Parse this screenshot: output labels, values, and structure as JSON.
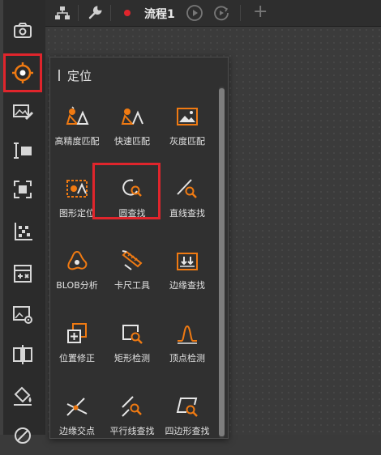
{
  "colors": {
    "accent": "#f07a12",
    "icon_gray": "#d7d7d7",
    "highlight_red": "#e0252c",
    "panel_bg": "#303030"
  },
  "left_toolbar": {
    "items": [
      {
        "name": "camera-icon"
      },
      {
        "name": "locate-target-icon",
        "active": true
      },
      {
        "name": "image-edit-icon"
      },
      {
        "name": "measure-icon"
      },
      {
        "name": "focus-frame-icon"
      },
      {
        "name": "grid-scatter-icon"
      },
      {
        "name": "calculator-icon"
      },
      {
        "name": "image-settings-icon"
      },
      {
        "name": "compare-icon"
      },
      {
        "name": "paint-bucket-icon"
      },
      {
        "name": "more-icon"
      }
    ]
  },
  "top_bar": {
    "tab_title": "流程1",
    "icons": [
      "hierarchy-icon",
      "wrench-icon",
      "play-icon",
      "loop-play-icon"
    ],
    "add_tab": "+"
  },
  "panel": {
    "title": "定位",
    "tools": [
      {
        "label": "高精度匹配",
        "icon": "high-precision-match-icon"
      },
      {
        "label": "快速匹配",
        "icon": "fast-match-icon"
      },
      {
        "label": "灰度匹配",
        "icon": "gray-match-icon"
      },
      {
        "label": "图形定位",
        "icon": "shape-locate-icon"
      },
      {
        "label": "圆查找",
        "icon": "circle-find-icon",
        "highlighted": true
      },
      {
        "label": "直线查找",
        "icon": "line-find-icon"
      },
      {
        "label": "BLOB分析",
        "icon": "blob-analysis-icon"
      },
      {
        "label": "卡尺工具",
        "icon": "caliper-tool-icon"
      },
      {
        "label": "边缘查找",
        "icon": "edge-find-icon"
      },
      {
        "label": "位置修正",
        "icon": "position-correct-icon"
      },
      {
        "label": "矩形检测",
        "icon": "rectangle-detect-icon"
      },
      {
        "label": "顶点检测",
        "icon": "vertex-detect-icon"
      },
      {
        "label": "边缘交点",
        "icon": "edge-intersection-icon"
      },
      {
        "label": "平行线查找",
        "icon": "parallel-line-find-icon"
      },
      {
        "label": "四边形查找",
        "icon": "quadrilateral-find-icon"
      }
    ]
  }
}
